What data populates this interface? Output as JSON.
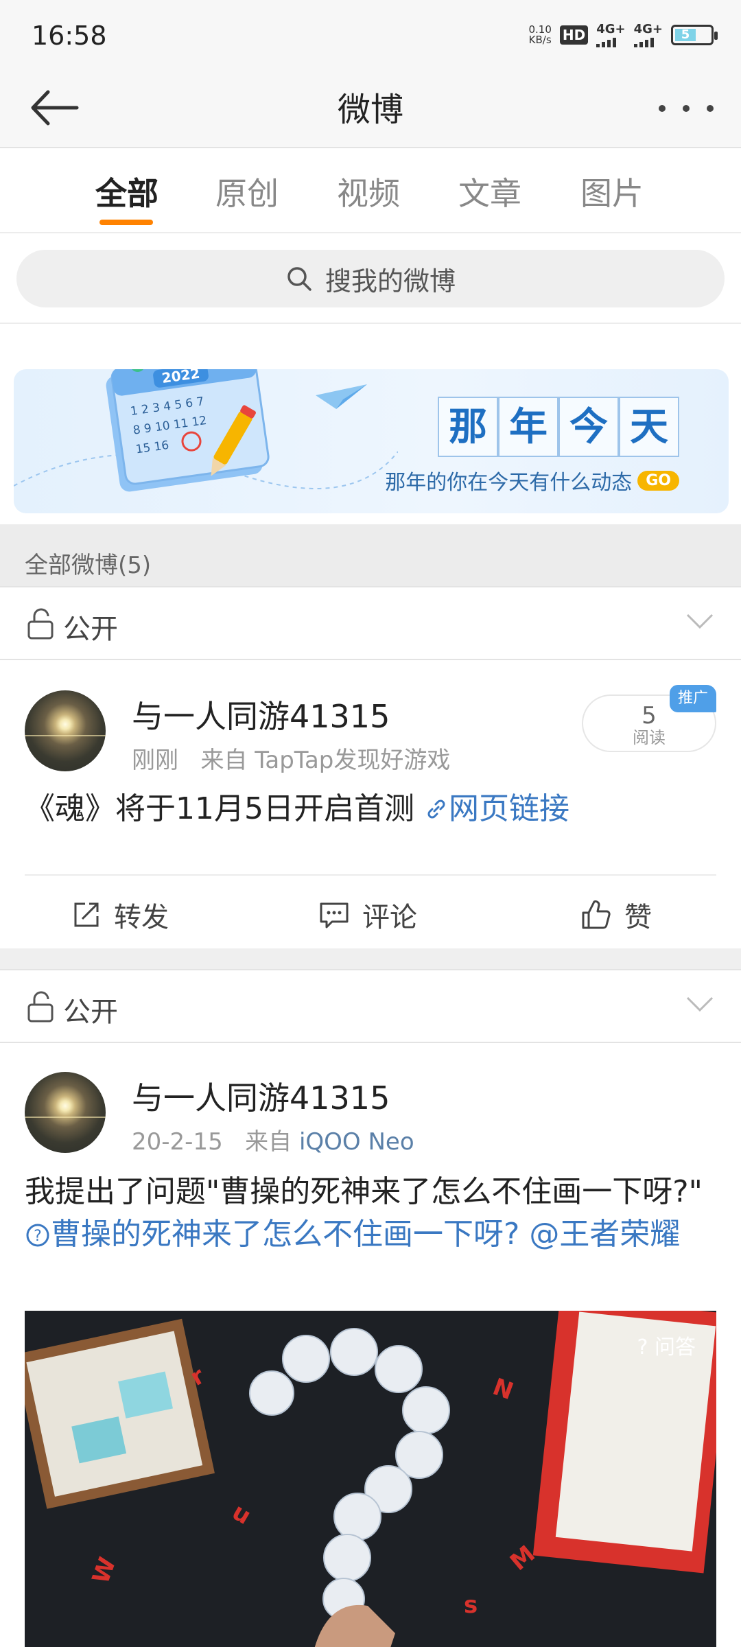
{
  "status_bar": {
    "time": "16:58",
    "net_speed_value": "0.10",
    "net_speed_unit": "KB/s",
    "hd_label": "HD",
    "signal_1": "4G+",
    "signal_2": "4G+",
    "battery": "5"
  },
  "header": {
    "title": "微博"
  },
  "tabs": [
    {
      "label": "全部",
      "active": true
    },
    {
      "label": "原创",
      "active": false
    },
    {
      "label": "视频",
      "active": false
    },
    {
      "label": "文章",
      "active": false
    },
    {
      "label": "图片",
      "active": false
    }
  ],
  "search": {
    "placeholder": "搜我的微博"
  },
  "banner": {
    "title_chars": [
      "那",
      "年",
      "今",
      "天"
    ],
    "subtitle": "那年的你在今天有什么动态",
    "go_label": "GO",
    "calendar_year": "2022"
  },
  "section": {
    "title": "全部微博(5)"
  },
  "posts": [
    {
      "visibility": "公开",
      "username": "与一人同游41315",
      "time": "刚刚",
      "source_prefix": "来自",
      "source": "TapTap发现好游戏",
      "text": "《魂》将于11月5日开启首测",
      "link_text": "网页链接",
      "read_count": "5",
      "read_label": "阅读",
      "promo_label": "推广",
      "actions": {
        "repost": "转发",
        "comment": "评论",
        "like": "赞"
      }
    },
    {
      "visibility": "公开",
      "username": "与一人同游41315",
      "time": "20-2-15",
      "source_prefix": "来自",
      "source": "iQOO Neo",
      "text": "我提出了问题\"曹操的死神来了怎么不住画一下呀?\"",
      "link_text": "曹操的死神来了怎么不住画一下呀?",
      "mention": "@王者荣耀",
      "image_badge": "问答"
    }
  ],
  "colors": {
    "accent": "#ff8200",
    "link": "#3a78c2",
    "promo": "#4f9fe8"
  }
}
